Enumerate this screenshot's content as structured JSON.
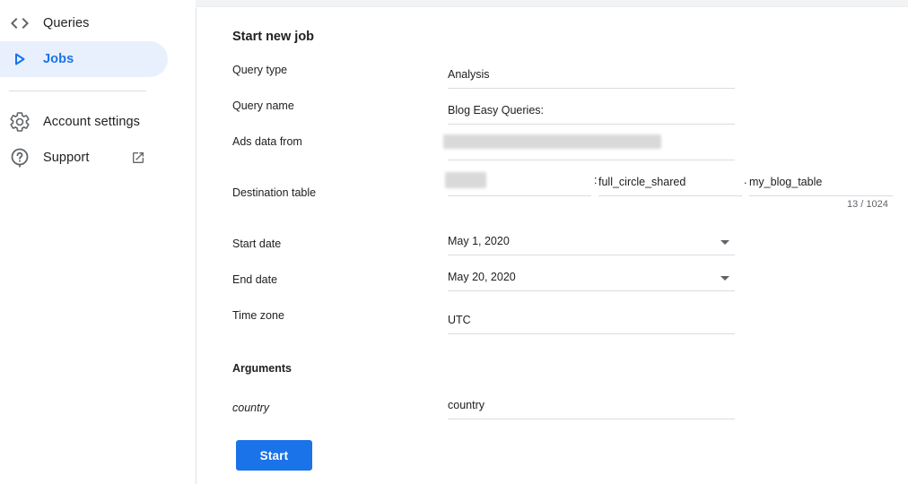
{
  "sidebar": {
    "items": [
      {
        "label": "Queries",
        "icon": "code-icon"
      },
      {
        "label": "Jobs",
        "icon": "play-icon"
      },
      {
        "label": "Account settings",
        "icon": "gear-icon"
      },
      {
        "label": "Support",
        "icon": "help-icon"
      }
    ]
  },
  "form": {
    "title": "Start new job",
    "query_type_label": "Query type",
    "query_type_value": "Analysis",
    "query_name_label": "Query name",
    "query_name_value": "Blog Easy Queries:",
    "ads_data_label": "Ads data from",
    "destination_label": "Destination table",
    "destination_dataset_sep": ":",
    "destination_dataset": "full_circle_shared",
    "destination_table_sep": ".",
    "destination_table": "my_blog_table",
    "destination_counter": "13 / 1024",
    "start_date_label": "Start date",
    "start_date_value": "May 1, 2020",
    "end_date_label": "End date",
    "end_date_value": "May 20, 2020",
    "time_zone_label": "Time zone",
    "time_zone_value": "UTC",
    "arguments_heading": "Arguments",
    "arg_country_label": "country",
    "arg_country_value": "country",
    "start_button": "Start"
  },
  "colors": {
    "accent": "#1a73e8",
    "active_bg": "#e8f0fe",
    "divider": "#dadce0"
  }
}
